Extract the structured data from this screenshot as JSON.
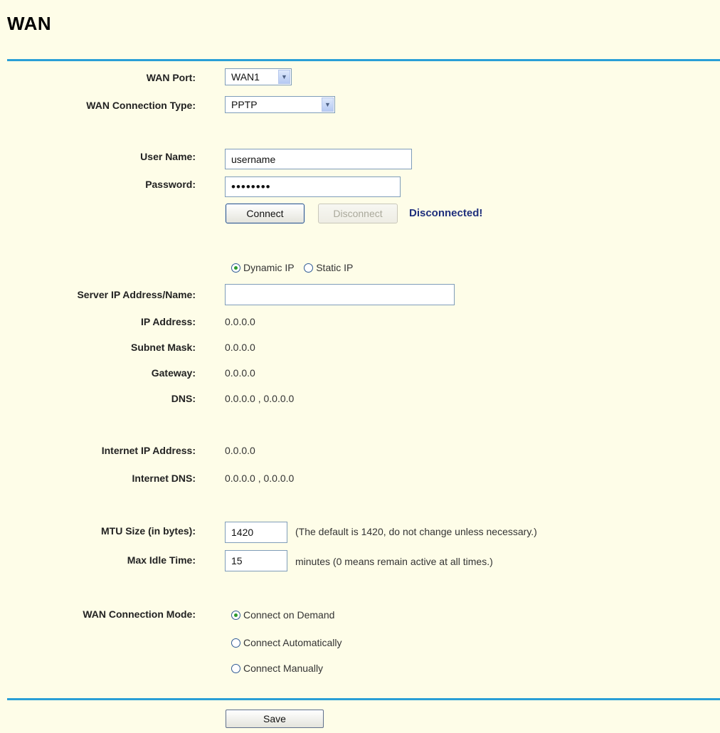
{
  "page": {
    "title": "WAN"
  },
  "wan_port": {
    "label": "WAN Port:",
    "value": "WAN1"
  },
  "connection_type": {
    "label": "WAN Connection Type:",
    "value": "PPTP"
  },
  "user_name": {
    "label": "User Name:",
    "value": "username"
  },
  "password": {
    "label": "Password:",
    "value": "••••••••"
  },
  "buttons": {
    "connect": "Connect",
    "disconnect": "Disconnect",
    "save": "Save"
  },
  "status": {
    "text": "Disconnected!",
    "color": "#1f2f7c"
  },
  "ip_mode": {
    "dynamic_label": "Dynamic IP",
    "static_label": "Static IP",
    "selected": "dynamic"
  },
  "server": {
    "label": "Server IP Address/Name:",
    "value": ""
  },
  "ip_address": {
    "label": "IP Address:",
    "value": "0.0.0.0"
  },
  "subnet_mask": {
    "label": "Subnet Mask:",
    "value": "0.0.0.0"
  },
  "gateway": {
    "label": "Gateway:",
    "value": "0.0.0.0"
  },
  "dns": {
    "label": "DNS:",
    "value": "0.0.0.0 , 0.0.0.0"
  },
  "internet_ip": {
    "label": "Internet IP Address:",
    "value": "0.0.0.0"
  },
  "internet_dns": {
    "label": "Internet DNS:",
    "value": "0.0.0.0 , 0.0.0.0"
  },
  "mtu": {
    "label": "MTU Size (in bytes):",
    "value": "1420",
    "note": "(The default is 1420, do not change unless necessary.)"
  },
  "max_idle": {
    "label": "Max Idle Time:",
    "value": "15",
    "note": "minutes (0 means remain active at all times.)"
  },
  "connection_mode": {
    "label": "WAN Connection Mode:",
    "options": [
      "Connect on Demand",
      "Connect Automatically",
      "Connect Manually"
    ],
    "selected": "Connect on Demand"
  },
  "colors": {
    "background": "#fefde8",
    "rule": "#2a9fd6"
  },
  "icons": {
    "dropdown": "chevron-down-icon",
    "radio": "radio-button-icon"
  }
}
